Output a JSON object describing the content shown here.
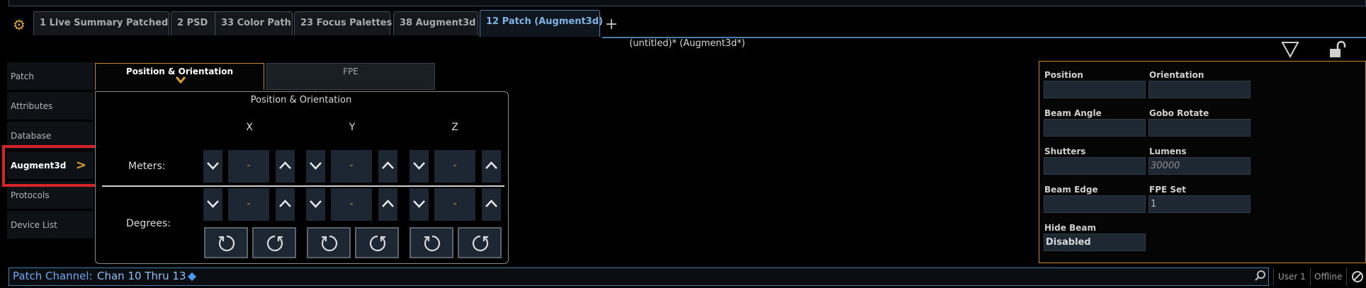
{
  "tabs": [
    {
      "label": "1 Live Summary Patched"
    },
    {
      "label": "2 PSD"
    },
    {
      "label": "33 Color Path"
    },
    {
      "label": "23 Focus Palettes"
    },
    {
      "label": "38 Augment3d"
    },
    {
      "label": "12 Patch (Augment3d)"
    }
  ],
  "add_tab_label": "+",
  "document_title": "(untitled)* (Augment3d*)",
  "nav": {
    "items": [
      {
        "label": "Patch"
      },
      {
        "label": "Attributes"
      },
      {
        "label": "Database"
      },
      {
        "label": "Augment3d"
      },
      {
        "label": "Protocols"
      },
      {
        "label": "Device List"
      }
    ],
    "active": "Augment3d"
  },
  "subtabs": {
    "position": "Position & Orientation",
    "fpe": "FPE"
  },
  "panel": {
    "title": "Position & Orientation",
    "axes": {
      "x": "X",
      "y": "Y",
      "z": "Z"
    },
    "meters_label": "Meters:",
    "degrees_label": "Degrees:",
    "meters": {
      "x": "-",
      "y": "-",
      "z": "-"
    },
    "degrees": {
      "x": "-",
      "y": "-",
      "z": "-"
    }
  },
  "properties": {
    "position": {
      "label": "Position",
      "value": ""
    },
    "orientation": {
      "label": "Orientation",
      "value": ""
    },
    "beam_angle": {
      "label": "Beam Angle",
      "value": ""
    },
    "gobo_rotate": {
      "label": "Gobo Rotate",
      "value": ""
    },
    "shutters": {
      "label": "Shutters",
      "value": ""
    },
    "lumens": {
      "label": "Lumens",
      "value": "30000"
    },
    "beam_edge": {
      "label": "Beam Edge",
      "value": ""
    },
    "fpe_set": {
      "label": "FPE Set",
      "value": "1"
    },
    "hide_beam": {
      "label": "Hide Beam",
      "value": "Disabled"
    }
  },
  "command_line": {
    "label": "Patch Channel:",
    "value": "Chan 10 Thru 13"
  },
  "status": {
    "user": "User 1",
    "connection": "Offline"
  },
  "colors": {
    "accent_orange": "#c8842a",
    "accent_blue": "#4a7ea8",
    "highlight_red": "#d6232a"
  }
}
